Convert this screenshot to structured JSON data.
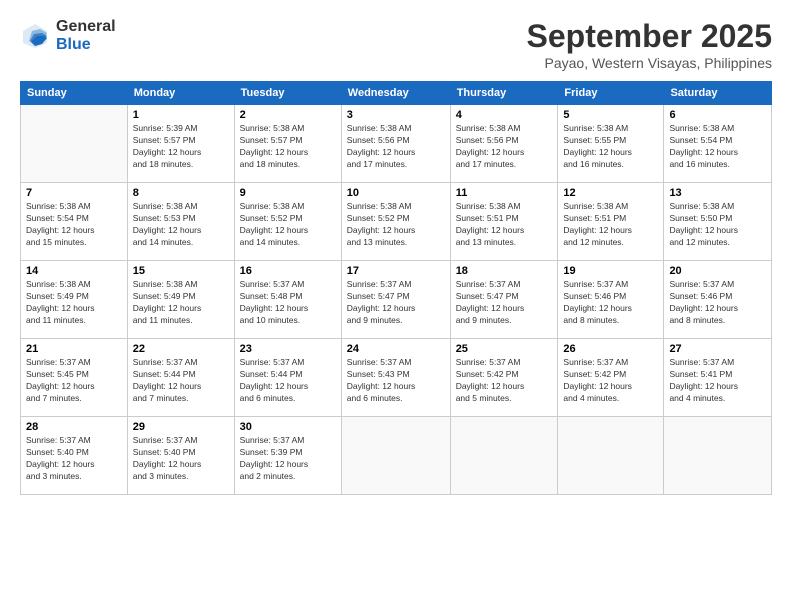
{
  "header": {
    "logo_general": "General",
    "logo_blue": "Blue",
    "month_title": "September 2025",
    "location": "Payao, Western Visayas, Philippines"
  },
  "days_of_week": [
    "Sunday",
    "Monday",
    "Tuesday",
    "Wednesday",
    "Thursday",
    "Friday",
    "Saturday"
  ],
  "weeks": [
    [
      {
        "day": "",
        "info": ""
      },
      {
        "day": "1",
        "info": "Sunrise: 5:39 AM\nSunset: 5:57 PM\nDaylight: 12 hours\nand 18 minutes."
      },
      {
        "day": "2",
        "info": "Sunrise: 5:38 AM\nSunset: 5:57 PM\nDaylight: 12 hours\nand 18 minutes."
      },
      {
        "day": "3",
        "info": "Sunrise: 5:38 AM\nSunset: 5:56 PM\nDaylight: 12 hours\nand 17 minutes."
      },
      {
        "day": "4",
        "info": "Sunrise: 5:38 AM\nSunset: 5:56 PM\nDaylight: 12 hours\nand 17 minutes."
      },
      {
        "day": "5",
        "info": "Sunrise: 5:38 AM\nSunset: 5:55 PM\nDaylight: 12 hours\nand 16 minutes."
      },
      {
        "day": "6",
        "info": "Sunrise: 5:38 AM\nSunset: 5:54 PM\nDaylight: 12 hours\nand 16 minutes."
      }
    ],
    [
      {
        "day": "7",
        "info": "Sunrise: 5:38 AM\nSunset: 5:54 PM\nDaylight: 12 hours\nand 15 minutes."
      },
      {
        "day": "8",
        "info": "Sunrise: 5:38 AM\nSunset: 5:53 PM\nDaylight: 12 hours\nand 14 minutes."
      },
      {
        "day": "9",
        "info": "Sunrise: 5:38 AM\nSunset: 5:52 PM\nDaylight: 12 hours\nand 14 minutes."
      },
      {
        "day": "10",
        "info": "Sunrise: 5:38 AM\nSunset: 5:52 PM\nDaylight: 12 hours\nand 13 minutes."
      },
      {
        "day": "11",
        "info": "Sunrise: 5:38 AM\nSunset: 5:51 PM\nDaylight: 12 hours\nand 13 minutes."
      },
      {
        "day": "12",
        "info": "Sunrise: 5:38 AM\nSunset: 5:51 PM\nDaylight: 12 hours\nand 12 minutes."
      },
      {
        "day": "13",
        "info": "Sunrise: 5:38 AM\nSunset: 5:50 PM\nDaylight: 12 hours\nand 12 minutes."
      }
    ],
    [
      {
        "day": "14",
        "info": "Sunrise: 5:38 AM\nSunset: 5:49 PM\nDaylight: 12 hours\nand 11 minutes."
      },
      {
        "day": "15",
        "info": "Sunrise: 5:38 AM\nSunset: 5:49 PM\nDaylight: 12 hours\nand 11 minutes."
      },
      {
        "day": "16",
        "info": "Sunrise: 5:37 AM\nSunset: 5:48 PM\nDaylight: 12 hours\nand 10 minutes."
      },
      {
        "day": "17",
        "info": "Sunrise: 5:37 AM\nSunset: 5:47 PM\nDaylight: 12 hours\nand 9 minutes."
      },
      {
        "day": "18",
        "info": "Sunrise: 5:37 AM\nSunset: 5:47 PM\nDaylight: 12 hours\nand 9 minutes."
      },
      {
        "day": "19",
        "info": "Sunrise: 5:37 AM\nSunset: 5:46 PM\nDaylight: 12 hours\nand 8 minutes."
      },
      {
        "day": "20",
        "info": "Sunrise: 5:37 AM\nSunset: 5:46 PM\nDaylight: 12 hours\nand 8 minutes."
      }
    ],
    [
      {
        "day": "21",
        "info": "Sunrise: 5:37 AM\nSunset: 5:45 PM\nDaylight: 12 hours\nand 7 minutes."
      },
      {
        "day": "22",
        "info": "Sunrise: 5:37 AM\nSunset: 5:44 PM\nDaylight: 12 hours\nand 7 minutes."
      },
      {
        "day": "23",
        "info": "Sunrise: 5:37 AM\nSunset: 5:44 PM\nDaylight: 12 hours\nand 6 minutes."
      },
      {
        "day": "24",
        "info": "Sunrise: 5:37 AM\nSunset: 5:43 PM\nDaylight: 12 hours\nand 6 minutes."
      },
      {
        "day": "25",
        "info": "Sunrise: 5:37 AM\nSunset: 5:42 PM\nDaylight: 12 hours\nand 5 minutes."
      },
      {
        "day": "26",
        "info": "Sunrise: 5:37 AM\nSunset: 5:42 PM\nDaylight: 12 hours\nand 4 minutes."
      },
      {
        "day": "27",
        "info": "Sunrise: 5:37 AM\nSunset: 5:41 PM\nDaylight: 12 hours\nand 4 minutes."
      }
    ],
    [
      {
        "day": "28",
        "info": "Sunrise: 5:37 AM\nSunset: 5:40 PM\nDaylight: 12 hours\nand 3 minutes."
      },
      {
        "day": "29",
        "info": "Sunrise: 5:37 AM\nSunset: 5:40 PM\nDaylight: 12 hours\nand 3 minutes."
      },
      {
        "day": "30",
        "info": "Sunrise: 5:37 AM\nSunset: 5:39 PM\nDaylight: 12 hours\nand 2 minutes."
      },
      {
        "day": "",
        "info": ""
      },
      {
        "day": "",
        "info": ""
      },
      {
        "day": "",
        "info": ""
      },
      {
        "day": "",
        "info": ""
      }
    ]
  ]
}
